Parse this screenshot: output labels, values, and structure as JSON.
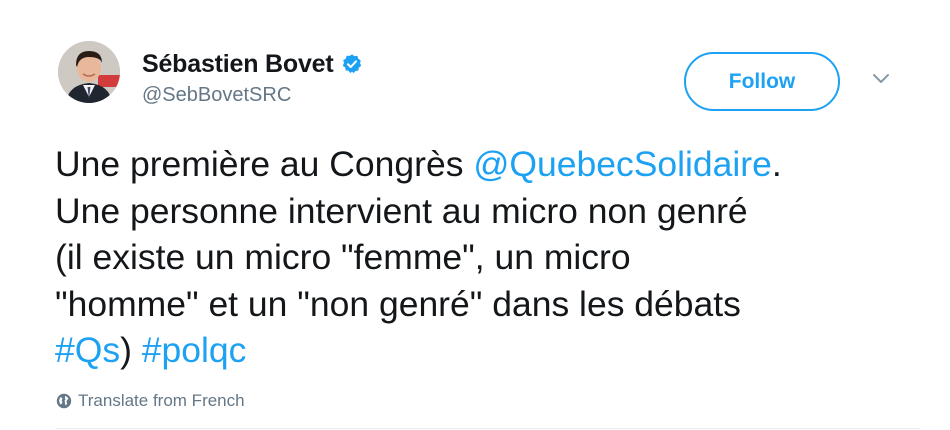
{
  "author": {
    "display_name": "Sébastien Bovet",
    "handle": "@SebBovetSRC",
    "verified": true
  },
  "follow_button": {
    "label": "Follow"
  },
  "tweet": {
    "line1": {
      "prefix": "Une première au Congrès ",
      "mention": "@QuebecSolidaire",
      "suffix": "."
    },
    "line2": "Une personne intervient au micro non genré",
    "line3": "(il existe un micro \"femme\", un micro",
    "line4": "\"homme\" et un \"non genré\" dans les débats",
    "line5": {
      "hashtag1": "#Qs",
      "middle": ") ",
      "hashtag2": "#polqc"
    }
  },
  "translate": {
    "label": "Translate from French"
  },
  "colors": {
    "accent": "#1da1f2",
    "text": "#14171a",
    "secondary": "#657786"
  },
  "icons": {
    "verified": "verified-badge-icon",
    "caret": "chevron-down-icon",
    "translate": "globe-icon"
  }
}
